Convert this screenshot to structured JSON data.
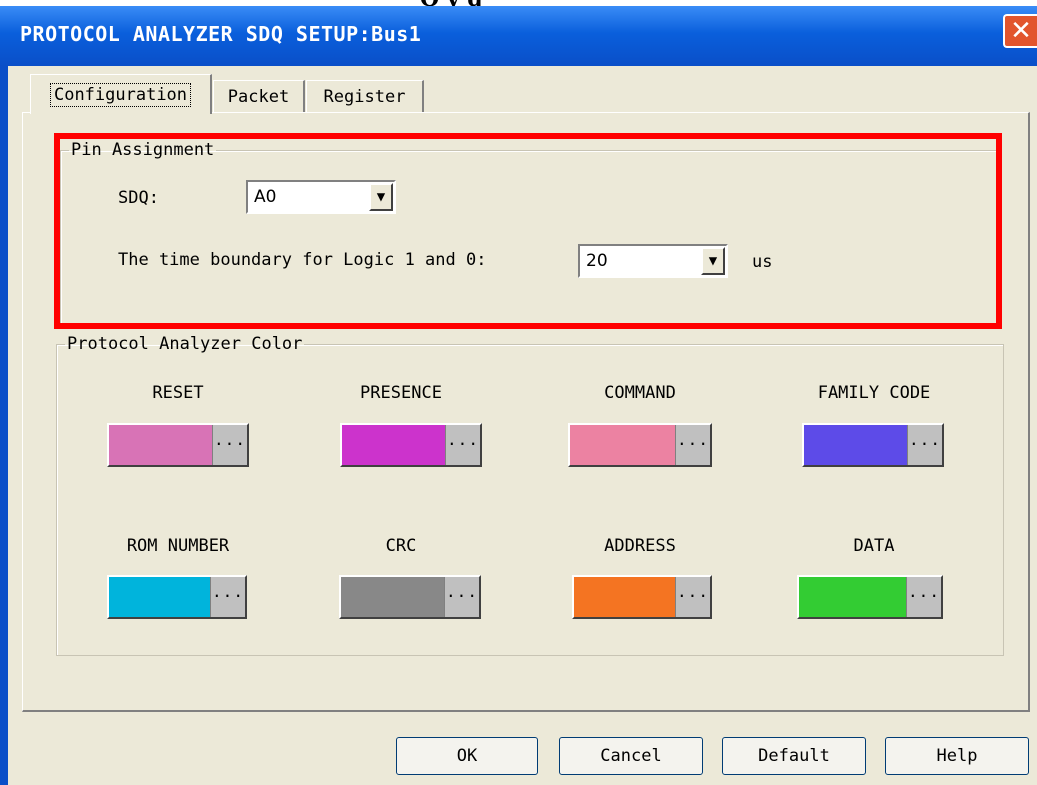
{
  "window": {
    "title": "PROTOCOL ANALYZER SDQ SETUP:Bus1",
    "close_glyph": "✕",
    "cropped_header_text": "Q                    y    g"
  },
  "tabs": [
    {
      "label": "Configuration",
      "active": true
    },
    {
      "label": "Packet",
      "active": false
    },
    {
      "label": "Register",
      "active": false
    }
  ],
  "pin_assignment": {
    "legend": "Pin Assignment",
    "sdq_label": "SDQ:",
    "sdq_value": "A0",
    "boundary_label": "The time boundary for Logic 1 and 0:",
    "boundary_value": "20",
    "boundary_unit": "us",
    "dropdown_glyph": "▼",
    "highlight_color": "#ff0000"
  },
  "color_group": {
    "legend": "Protocol Analyzer Color",
    "picker_glyph": "...",
    "items": [
      {
        "label": "RESET",
        "color": "#d873b6"
      },
      {
        "label": "PRESENCE",
        "color": "#cc33cc"
      },
      {
        "label": "COMMAND",
        "color": "#ec82a2"
      },
      {
        "label": "FAMILY CODE",
        "color": "#5d4be8"
      },
      {
        "label": "ROM NUMBER",
        "color": "#00b4dc"
      },
      {
        "label": "CRC",
        "color": "#888888"
      },
      {
        "label": "ADDRESS",
        "color": "#f47422"
      },
      {
        "label": "DATA",
        "color": "#33cc33"
      }
    ]
  },
  "buttons": {
    "ok": "OK",
    "cancel": "Cancel",
    "default": "Default",
    "help": "Help"
  }
}
